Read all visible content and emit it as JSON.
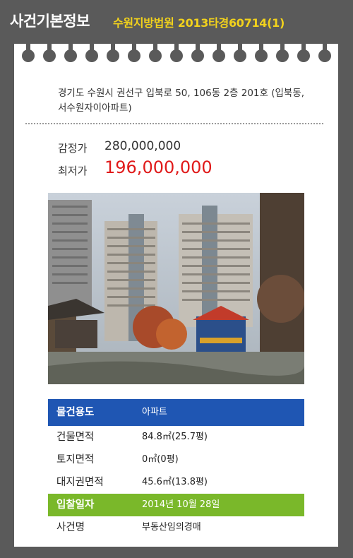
{
  "header": {
    "title": "사건기본정보",
    "case_info": "수원지방법원 2013타경60714(1)"
  },
  "property": {
    "address": "경기도 수원시 권선구 입북로 50, 106동 2층 201호 (입북동,서수원자이아파트)",
    "appraisal_label": "감정가",
    "appraisal_value": "280,000,000",
    "min_price_label": "최저가",
    "min_price_value": "196,000,000"
  },
  "details": [
    {
      "label": "물건용도",
      "value": "아파트",
      "highlight": "blue"
    },
    {
      "label": "건물면적",
      "value": "84.8㎡(25.7평)"
    },
    {
      "label": "토지면적",
      "value": "0㎡(0평)"
    },
    {
      "label": "대지권면적",
      "value": "45.6㎡(13.8평)"
    },
    {
      "label": "입찰일자",
      "value": "2014년 10월 28일",
      "highlight": "green"
    },
    {
      "label": "사건명",
      "value": "부동산임의경매"
    }
  ],
  "colors": {
    "header_bg": "#5a5a5a",
    "case_text": "#f2d21c",
    "min_price": "#e01a1a",
    "row_blue": "#1f56b3",
    "row_green": "#7ab82a"
  },
  "photo": {
    "subject": "apartment-complex-playground"
  }
}
